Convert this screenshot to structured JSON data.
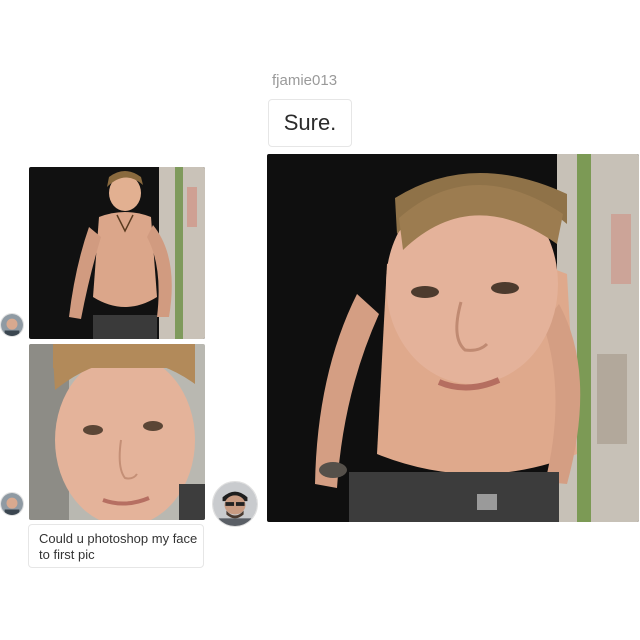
{
  "reply": {
    "username": "fjamie013",
    "message": "Sure."
  },
  "request": {
    "message": "Could u photoshop my face to first pic"
  },
  "images": {
    "first_pic": "shirtless-model-photo",
    "face_pic": "face-selfie-photo",
    "edited_pic": "photoshopped-result-photo"
  },
  "colors": {
    "background": "#ffffff",
    "bubble_border": "#e6e6e6",
    "username": "#9a9a9a"
  }
}
